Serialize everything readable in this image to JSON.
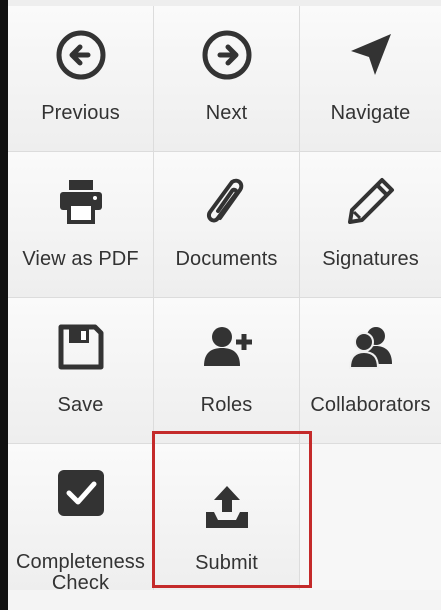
{
  "colors": {
    "icon": "#333333",
    "text": "#333333",
    "highlight": "#c42a2a"
  },
  "toolbar": {
    "previous": {
      "label": "Previous",
      "icon": "arrow-left-circle-icon"
    },
    "next": {
      "label": "Next",
      "icon": "arrow-right-circle-icon"
    },
    "navigate": {
      "label": "Navigate",
      "icon": "location-arrow-icon"
    },
    "view_pdf": {
      "label": "View as PDF",
      "icon": "printer-icon"
    },
    "documents": {
      "label": "Documents",
      "icon": "paperclip-icon"
    },
    "signatures": {
      "label": "Signatures",
      "icon": "pencil-icon"
    },
    "save": {
      "label": "Save",
      "icon": "floppy-disk-icon"
    },
    "roles": {
      "label": "Roles",
      "icon": "user-plus-icon"
    },
    "collaborators": {
      "label": "Collaborators",
      "icon": "users-icon"
    },
    "completeness": {
      "label_line1": "Completeness",
      "label_line2": "Check",
      "icon": "checkbox-icon"
    },
    "submit": {
      "label": "Submit",
      "icon": "upload-tray-icon"
    }
  }
}
